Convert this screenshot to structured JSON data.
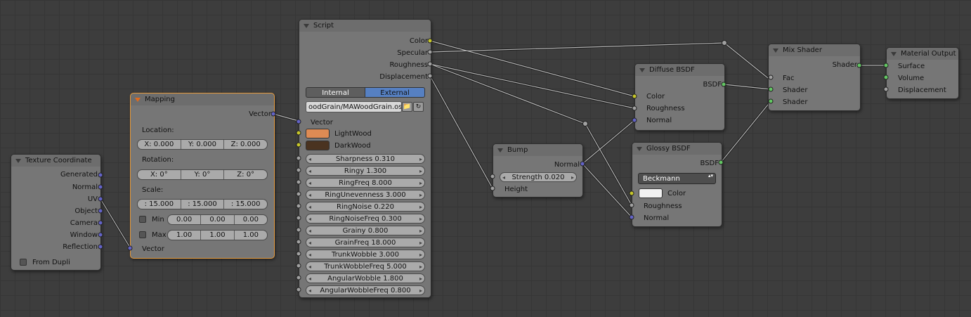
{
  "texture_coordinate": {
    "title": "Texture Coordinate",
    "outputs": [
      "Generated",
      "Normal",
      "UV",
      "Object",
      "Camera",
      "Window",
      "Reflection"
    ],
    "from_dupli": "From Dupli"
  },
  "mapping": {
    "title": "Mapping",
    "vector_out": "Vector",
    "location_label": "Location:",
    "location": [
      "X: 0.000",
      "Y: 0.000",
      "Z: 0.000"
    ],
    "rotation_label": "Rotation:",
    "rotation": [
      "X: 0°",
      "Y: 0°",
      "Z: 0°"
    ],
    "scale_label": "Scale:",
    "scale": [
      ": 15.000",
      ": 15.000",
      ": 15.000"
    ],
    "min_label": "Min",
    "min": [
      "0.00",
      "0.00",
      "0.00"
    ],
    "max_label": "Max",
    "max": [
      "1.00",
      "1.00",
      "1.00"
    ],
    "vector_in": "Vector"
  },
  "script": {
    "title": "Script",
    "outputs": [
      "Color",
      "Specular",
      "Roughness",
      "Displacement"
    ],
    "mode_internal": "Internal",
    "mode_external": "External",
    "filepath": "oodGrain/MAWoodGrain.osl",
    "vector_in": "Vector",
    "light_wood": "LightWood",
    "dark_wood": "DarkWood",
    "params": [
      "Sharpness 0.310",
      "Ringy 1.300",
      "RingFreq 8.000",
      "RingUnevenness 3.000",
      "RingNoise 0.220",
      "RingNoiseFreq 0.300",
      "Grainy 0.800",
      "GrainFreq 18.000",
      "TrunkWobble 3.000",
      "TrunkWobbleFreq 5.000",
      "AngularWobble 1.800",
      "AngularWobbleFreq 0.800"
    ]
  },
  "bump": {
    "title": "Bump",
    "normal_out": "Normal",
    "strength": "Strength 0.020",
    "height_in": "Height"
  },
  "diffuse": {
    "title": "Diffuse BSDF",
    "bsdf_out": "BSDF",
    "inputs": [
      "Color",
      "Roughness",
      "Normal"
    ]
  },
  "glossy": {
    "title": "Glossy BSDF",
    "bsdf_out": "BSDF",
    "distribution": "Beckmann",
    "inputs": [
      "Color",
      "Roughness",
      "Normal"
    ]
  },
  "mix": {
    "title": "Mix Shader",
    "shader_out": "Shader",
    "inputs": [
      "Fac",
      "Shader",
      "Shader"
    ]
  },
  "output": {
    "title": "Material Output",
    "inputs": [
      "Surface",
      "Volume",
      "Displacement"
    ]
  },
  "colors": {
    "light_wood": "#dd8b54",
    "dark_wood": "#4a3320",
    "glossy_color": "#f2f2f2",
    "external_active": "#5680c2",
    "socket_vector": "#6363c7",
    "socket_float": "#a1a1a1",
    "socket_color": "#c7c729",
    "socket_shader": "#63c763"
  }
}
